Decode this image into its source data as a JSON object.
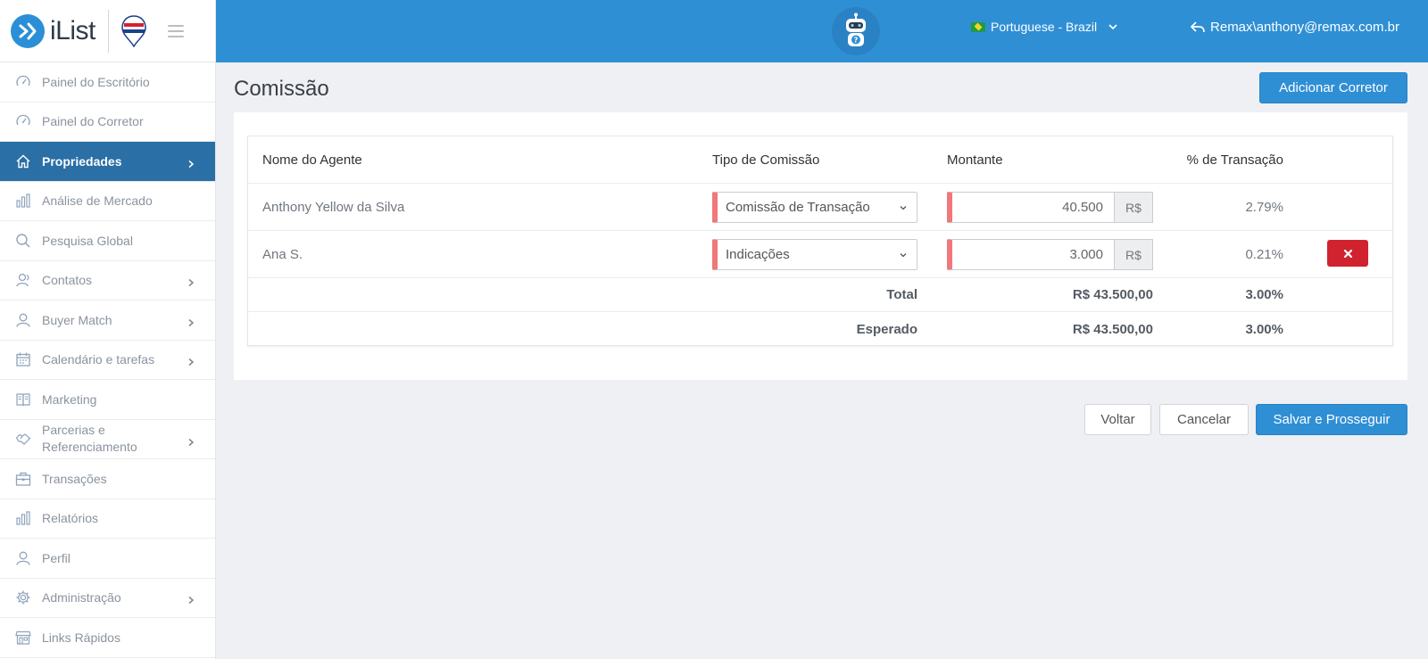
{
  "brand": {
    "name": "iList"
  },
  "sidebar": {
    "items": [
      {
        "label": "Painel do Escritório",
        "icon": "dashboard-gauge-icon",
        "chevron": false
      },
      {
        "label": "Painel do Corretor",
        "icon": "dashboard-gauge-icon",
        "chevron": false
      },
      {
        "label": "Propriedades",
        "icon": "home-icon",
        "chevron": true,
        "active": true
      },
      {
        "label": "Análise de Mercado",
        "icon": "bar-chart-icon",
        "chevron": false
      },
      {
        "label": "Pesquisa Global",
        "icon": "search-icon",
        "chevron": false
      },
      {
        "label": "Contatos",
        "icon": "contacts-icon",
        "chevron": true
      },
      {
        "label": "Buyer Match",
        "icon": "user-icon",
        "chevron": true
      },
      {
        "label": "Calendário e tarefas",
        "icon": "calendar-icon",
        "chevron": true
      },
      {
        "label": "Marketing",
        "icon": "book-icon",
        "chevron": false
      },
      {
        "label": "Parcerias e Referenciamento",
        "icon": "handshake-icon",
        "chevron": true
      },
      {
        "label": "Transações",
        "icon": "briefcase-icon",
        "chevron": false
      },
      {
        "label": "Relatórios",
        "icon": "bar-chart-icon",
        "chevron": false
      },
      {
        "label": "Perfil",
        "icon": "user-icon",
        "chevron": false
      },
      {
        "label": "Administração",
        "icon": "gear-icon",
        "chevron": true
      },
      {
        "label": "Links Rápidos",
        "icon": "storefront-icon",
        "chevron": false
      }
    ]
  },
  "topbar": {
    "language": "Portuguese - Brazil",
    "user": "Remax\\anthony@remax.com.br"
  },
  "page": {
    "title": "Comissão",
    "add_agent_label": "Adicionar Corretor"
  },
  "table": {
    "headers": {
      "agent": "Nome do Agente",
      "type": "Tipo de Comissão",
      "amount": "Montante",
      "percent": "% de Transação"
    },
    "rows": [
      {
        "agent": "Anthony Yellow da Silva",
        "type": "Comissão de Transação",
        "amount": "40.500",
        "currency": "R$",
        "percent": "2.79%",
        "deletable": false
      },
      {
        "agent": "Ana S.",
        "type": "Indicações",
        "amount": "3.000",
        "currency": "R$",
        "percent": "0.21%",
        "deletable": true
      }
    ],
    "total": {
      "label": "Total",
      "amount": "R$ 43.500,00",
      "percent": "3.00%"
    },
    "expected": {
      "label": "Esperado",
      "amount": "R$ 43.500,00",
      "percent": "3.00%"
    }
  },
  "footer": {
    "back_label": "Voltar",
    "cancel_label": "Cancelar",
    "save_label": "Salvar e Prosseguir"
  },
  "colors": {
    "topbar": "#2f8fd4",
    "sidebar_active": "#2a6fa5",
    "required_marker": "#f0787a",
    "danger": "#d0232f"
  }
}
